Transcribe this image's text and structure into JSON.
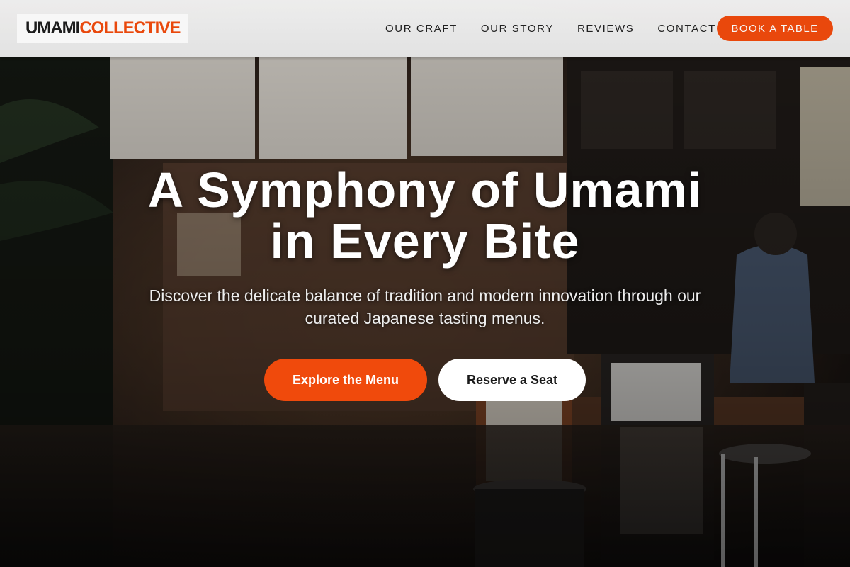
{
  "header": {
    "logo": {
      "part1": "UMAMI",
      "part2": "COLLECTIVE"
    },
    "nav": [
      "OUR CRAFT",
      "OUR STORY",
      "REVIEWS",
      "CONTACT"
    ],
    "cta": "BOOK A TABLE"
  },
  "hero": {
    "headline_line1": "A Symphony of Umami",
    "headline_line2": "in Every Bite",
    "subtitle_line1": "Discover the delicate balance of tradition and modern innovation through our",
    "subtitle_line2": "curated Japanese tasting menus.",
    "primary_button": "Explore the Menu",
    "secondary_button": "Reserve a Seat"
  },
  "colors": {
    "accent": "#f04a0c",
    "header_bg": "#efefef",
    "text_dark": "#1d1d1d",
    "text_light": "#ffffff"
  }
}
